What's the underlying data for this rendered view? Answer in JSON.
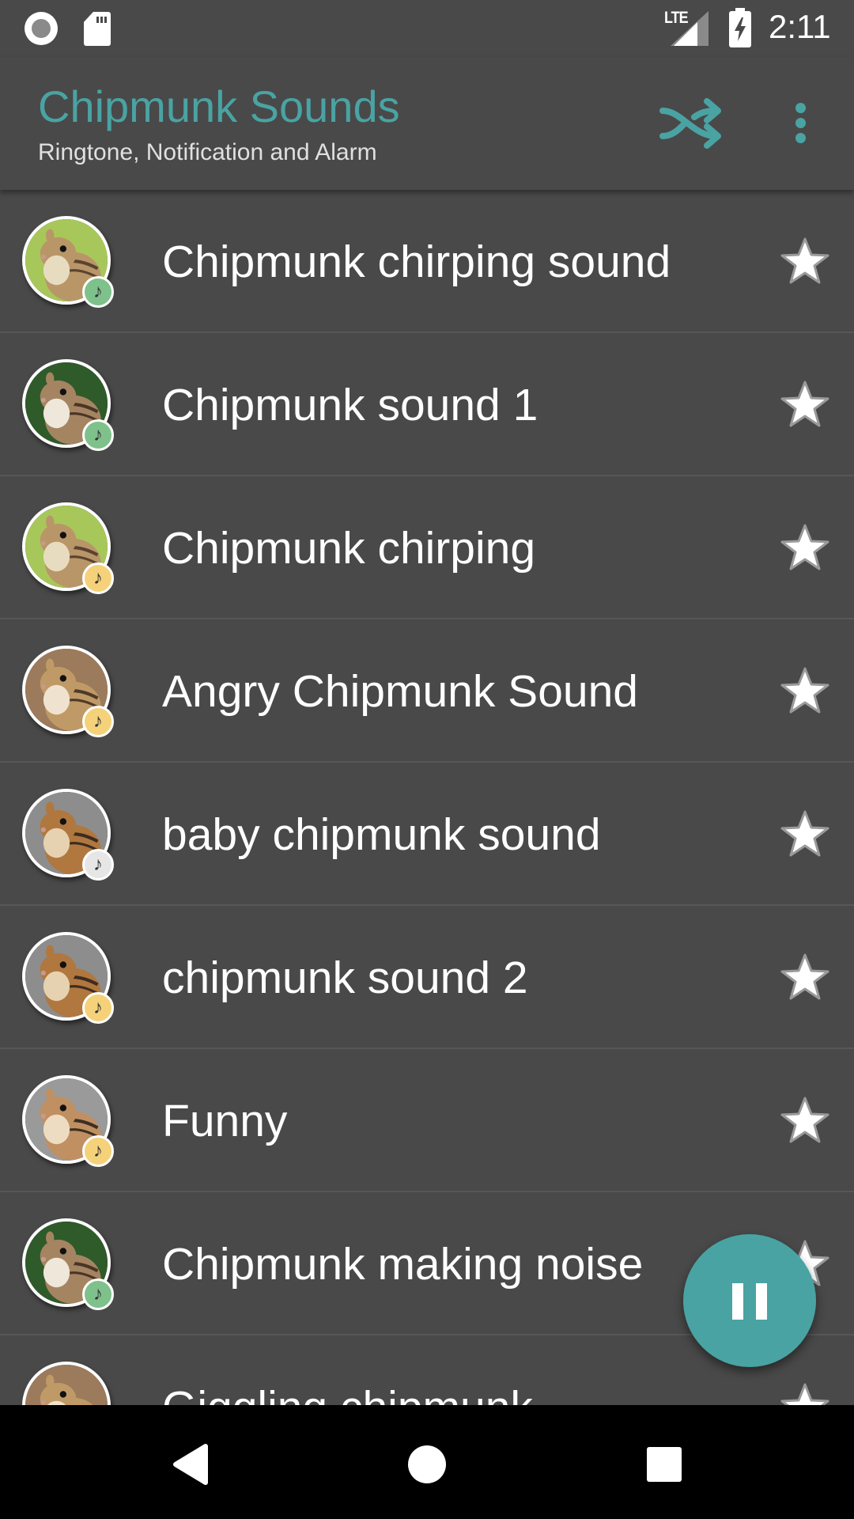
{
  "status_bar": {
    "time": "2:11",
    "network": "LTE",
    "icons": [
      "cast-icon",
      "sd-card-icon",
      "lte-signal-icon",
      "battery-charging-icon"
    ]
  },
  "app_bar": {
    "title": "Chipmunk Sounds",
    "subtitle": "Ringtone, Notification and Alarm",
    "actions": [
      "shuffle-icon",
      "more-vert-icon"
    ]
  },
  "colors": {
    "accent": "#4aa3a3",
    "background": "#494949",
    "badge_green": "#7fc18b",
    "badge_yellow": "#f5d27a",
    "badge_gray": "#e6e6e6"
  },
  "sounds": [
    {
      "title": "Chipmunk chirping sound",
      "badge": "green",
      "photo": "green-bg"
    },
    {
      "title": "Chipmunk sound 1",
      "badge": "green",
      "photo": "dark-green-bg"
    },
    {
      "title": "Chipmunk chirping",
      "badge": "yellow",
      "photo": "green-bg"
    },
    {
      "title": "Angry Chipmunk Sound",
      "badge": "yellow",
      "photo": "brown-bg"
    },
    {
      "title": "baby chipmunk sound",
      "badge": "gray",
      "photo": "rock-bg"
    },
    {
      "title": "chipmunk sound 2",
      "badge": "yellow",
      "photo": "rock-bg"
    },
    {
      "title": "Funny",
      "badge": "yellow",
      "photo": "rock-gray-bg"
    },
    {
      "title": "Chipmunk making noise",
      "badge": "green",
      "photo": "dark-green-bg"
    },
    {
      "title": "Giggling chipmunk",
      "badge": "yellow",
      "photo": "brown-bg"
    }
  ],
  "player": {
    "state": "playing",
    "fab_icon": "pause-icon"
  },
  "nav_bar": {
    "buttons": [
      "back-icon",
      "home-icon",
      "recents-icon"
    ]
  }
}
